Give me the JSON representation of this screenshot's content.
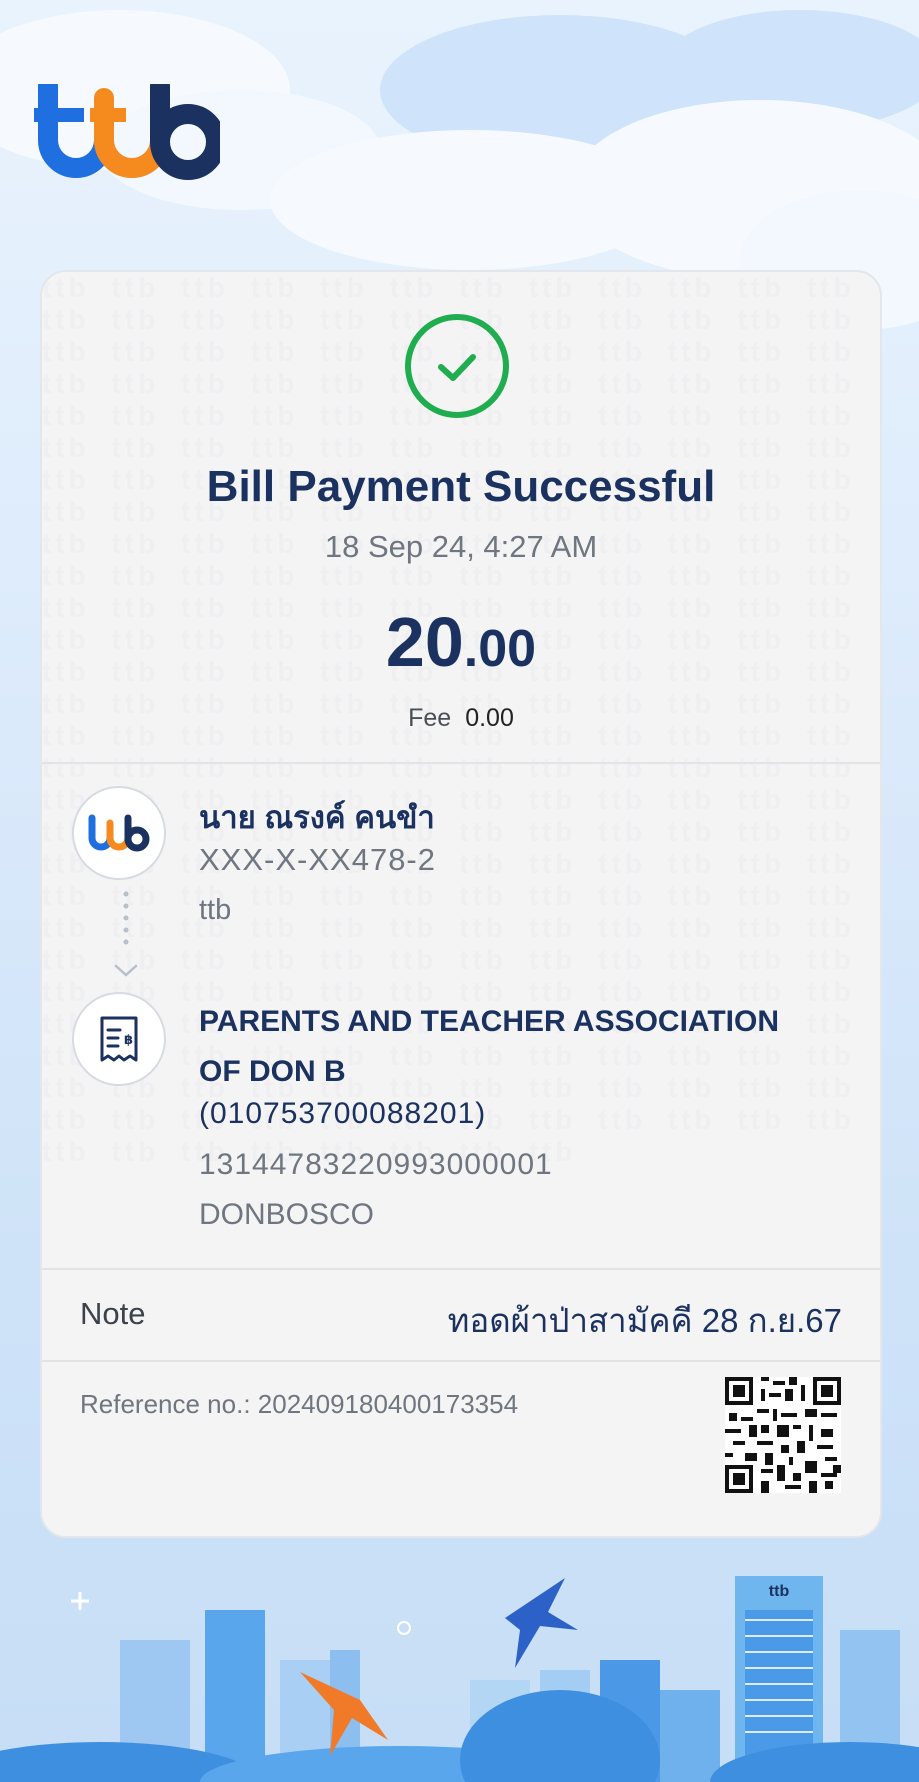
{
  "logo": {
    "text": "ttb"
  },
  "receipt": {
    "title": "Bill Payment Successful",
    "datetime": "18 Sep 24, 4:27 AM",
    "amount_int": "20",
    "amount_dec": ".00",
    "fee_label": "Fee",
    "fee_value": "0.00"
  },
  "from": {
    "name": "นาย ณรงค์ คนขำ",
    "account": "XXX-X-XX478-2",
    "bank": "ttb",
    "icon": "ttb-logo-icon"
  },
  "to": {
    "name": "PARENTS AND TEACHER ASSOCIATION OF DON B",
    "biller_id": "(010753700088201)",
    "ref1": "131447832209930000​01",
    "ref2": "DONBOSCO",
    "icon": "bill-receipt-icon"
  },
  "note": {
    "label": "Note",
    "value": "ทอดผ้าป่าสามัคคี 28 ก.ย.67"
  },
  "reference": {
    "text": "Reference no.: 2024091804001733​54"
  },
  "colors": {
    "navy": "#1b3260",
    "orange": "#f58a1f",
    "blue": "#1f6fe0",
    "success": "#1fad4f"
  }
}
